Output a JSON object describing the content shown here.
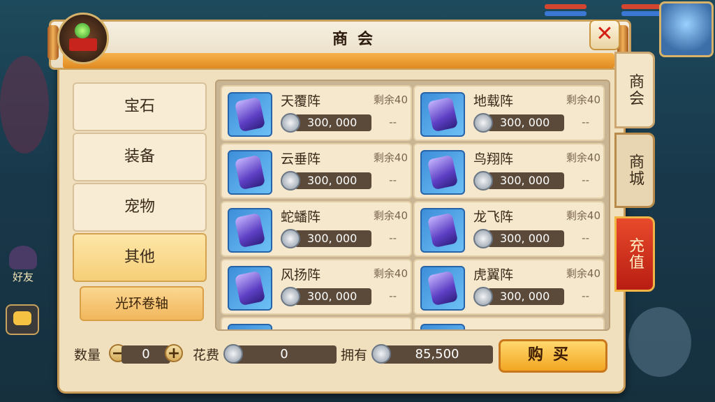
{
  "dialog": {
    "title": "商会"
  },
  "background": {
    "friends_label": "好友"
  },
  "categories": [
    {
      "label": "宝石",
      "active": false
    },
    {
      "label": "装备",
      "active": false
    },
    {
      "label": "宠物",
      "active": false
    },
    {
      "label": "其他",
      "active": true
    }
  ],
  "subcategory": {
    "label": "光环卷轴"
  },
  "items": [
    {
      "name": "天覆阵",
      "remain": "剩余40",
      "price": "300, 000",
      "dash": "--"
    },
    {
      "name": "地载阵",
      "remain": "剩余40",
      "price": "300, 000",
      "dash": "--"
    },
    {
      "name": "云垂阵",
      "remain": "剩余40",
      "price": "300, 000",
      "dash": "--"
    },
    {
      "name": "鸟翔阵",
      "remain": "剩余40",
      "price": "300, 000",
      "dash": "--"
    },
    {
      "name": "蛇蟠阵",
      "remain": "剩余40",
      "price": "300, 000",
      "dash": "--"
    },
    {
      "name": "龙飞阵",
      "remain": "剩余40",
      "price": "300, 000",
      "dash": "--"
    },
    {
      "name": "风扬阵",
      "remain": "剩余40",
      "price": "300, 000",
      "dash": "--"
    },
    {
      "name": "虎翼阵",
      "remain": "剩余40",
      "price": "300, 000",
      "dash": "--"
    }
  ],
  "bottom": {
    "qty_label": "数量",
    "qty_minus": "−",
    "qty_value": "0",
    "qty_plus": "+",
    "cost_label": "花费",
    "cost_value": "0",
    "own_label": "拥有",
    "own_value": "85,500",
    "buy_label": "购买"
  },
  "right_tabs": [
    {
      "label": "商会",
      "active": true
    },
    {
      "label": "商城",
      "active": false
    },
    {
      "label": "充值",
      "active": false
    }
  ],
  "colors": {
    "panel": "#f1e0bd",
    "accent": "#f2a622",
    "recharge": "#c8241e"
  }
}
